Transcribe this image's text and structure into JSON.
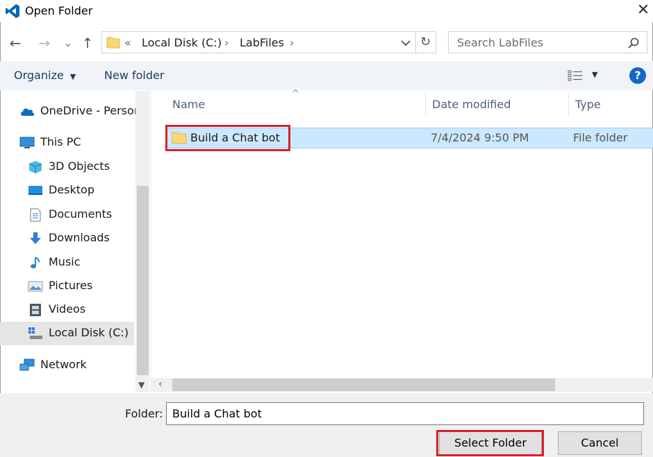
{
  "window": {
    "title": "Open Folder",
    "close_glyph": "✕"
  },
  "nav": {
    "back_glyph": "←",
    "forward_glyph": "→",
    "recent_glyph": "⌄",
    "up_glyph": "↑",
    "address": {
      "overflow": "«",
      "segment1": "Local Disk (C:)",
      "segment2": "LabFiles",
      "sep": "›"
    },
    "refresh_glyph": "↻",
    "search_placeholder": "Search LabFiles"
  },
  "toolbar": {
    "organize_label": "Organize",
    "new_folder_label": "New folder",
    "help_label": "?"
  },
  "sidebar": {
    "items": [
      {
        "label": "OneDrive - Persor",
        "icon": "cloud-icon"
      },
      {
        "label": "This PC",
        "icon": "computer-icon"
      },
      {
        "label": "3D Objects",
        "icon": "cube-icon"
      },
      {
        "label": "Desktop",
        "icon": "desktop-icon"
      },
      {
        "label": "Documents",
        "icon": "documents-icon"
      },
      {
        "label": "Downloads",
        "icon": "download-icon"
      },
      {
        "label": "Music",
        "icon": "music-icon"
      },
      {
        "label": "Pictures",
        "icon": "pictures-icon"
      },
      {
        "label": "Videos",
        "icon": "videos-icon"
      },
      {
        "label": "Local Disk (C:)",
        "icon": "drive-icon",
        "selected": true
      },
      {
        "label": "Network",
        "icon": "network-icon"
      }
    ]
  },
  "list": {
    "columns": [
      "Name",
      "Date modified",
      "Type"
    ],
    "rows": [
      {
        "name": "Build a Chat bot",
        "date": "7/4/2024 9:50 PM",
        "type": "File folder",
        "selected": true
      }
    ]
  },
  "footer": {
    "folder_label": "Folder:",
    "folder_value": "Build a Chat bot",
    "select_label": "Select Folder",
    "cancel_label": "Cancel"
  },
  "colors": {
    "highlight_red": "#d8202b",
    "selection": "#cce8ff",
    "vscode_blue": "#0066b8"
  }
}
